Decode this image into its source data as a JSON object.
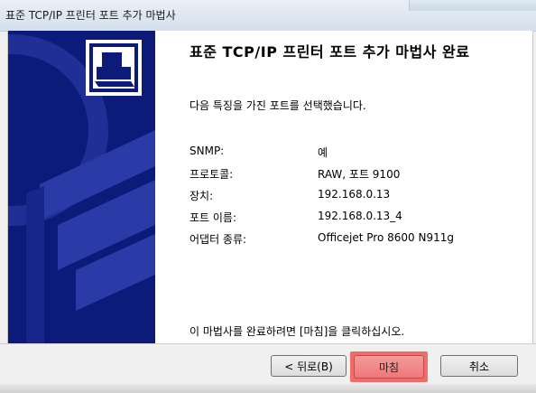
{
  "window": {
    "title": "표준 TCP/IP 프린터 포트 추가 마법사"
  },
  "heading": "표준 TCP/IP 프린터 포트 추가 마법사 완료",
  "description": "다음 특징을 가진 포트를 선택했습니다.",
  "properties": [
    {
      "label": "SNMP:",
      "value": "예"
    },
    {
      "label": "프로토콜:",
      "value": "RAW, 포트 9100"
    },
    {
      "label": "장치:",
      "value": "192.168.0.13"
    },
    {
      "label": "포트 이름:",
      "value": "192.168.0.13_4"
    },
    {
      "label": "어댑터 종류:",
      "value": "Officejet Pro 8600 N911g"
    }
  ],
  "footer_note": "이 마법사를 완료하려면 [마침]을 클릭하십시오.",
  "buttons": {
    "back": "< 뒤로(B)",
    "finish": "마침",
    "cancel": "취소"
  },
  "colors": {
    "banner": "#0c1a7a",
    "highlight": "#f26b6b"
  },
  "icons": {
    "banner": "printer-icon"
  }
}
